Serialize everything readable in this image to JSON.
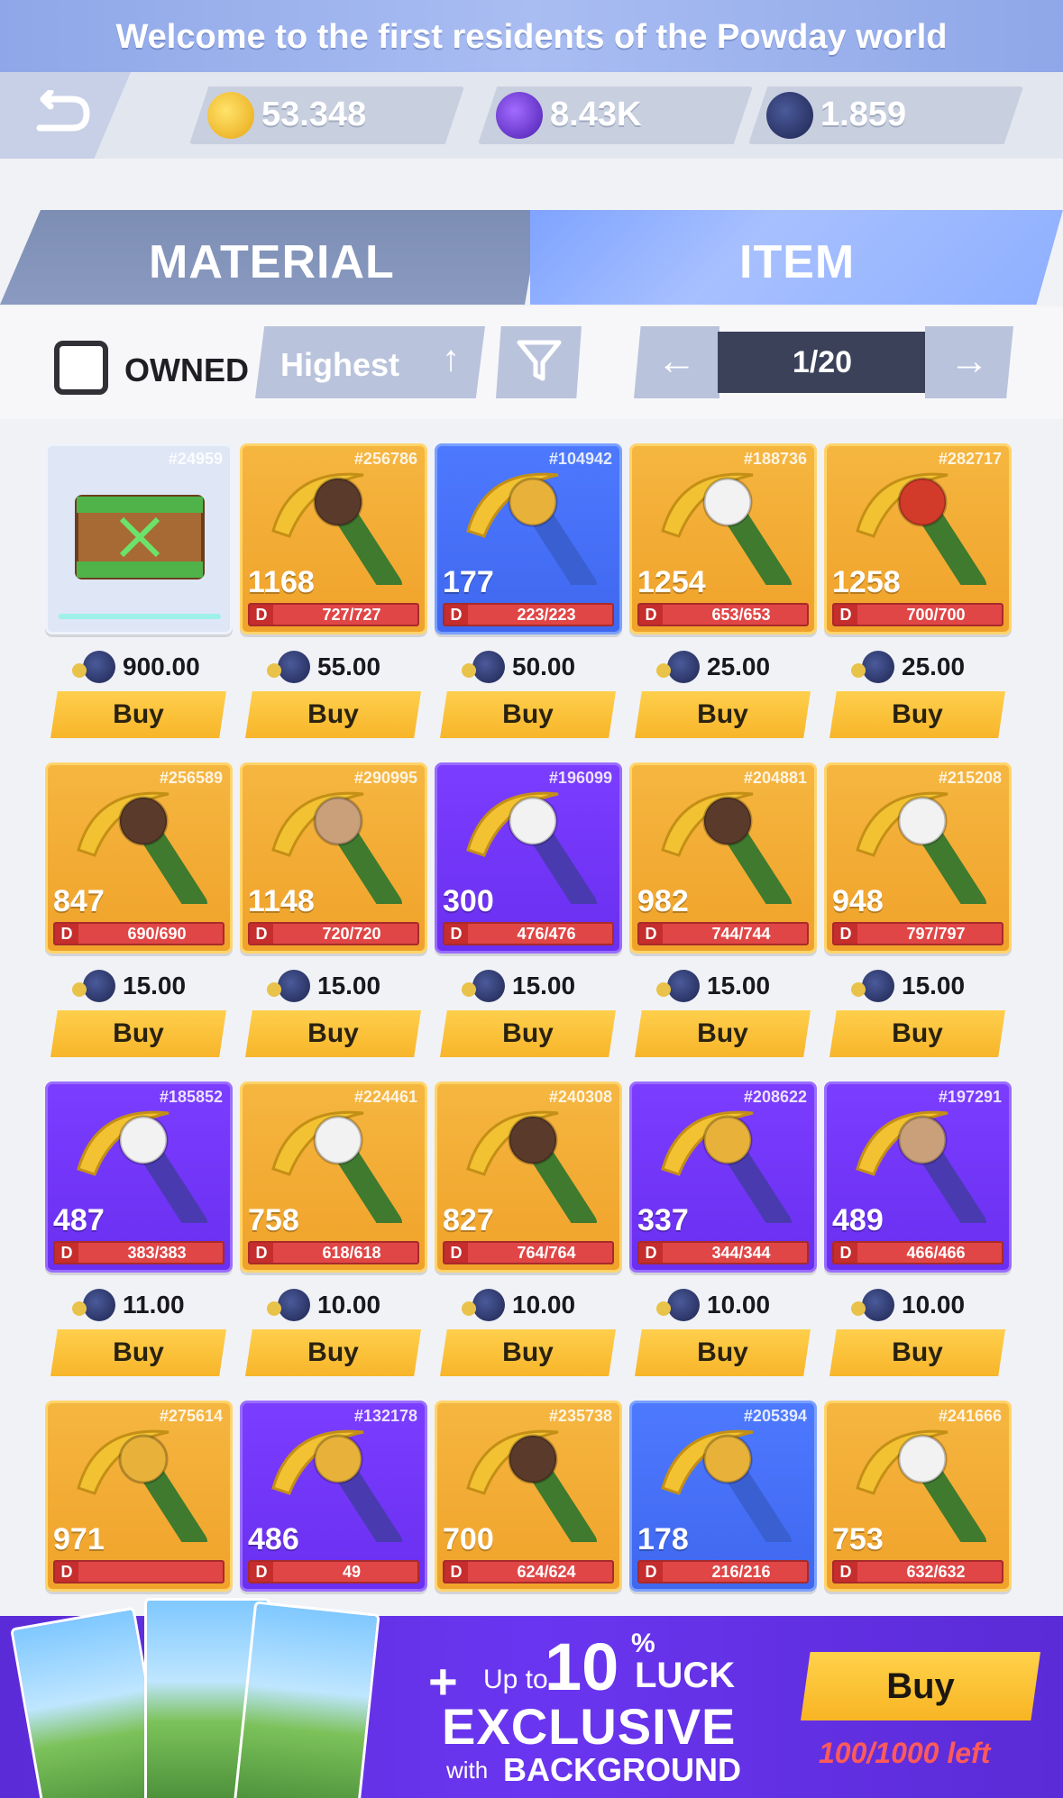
{
  "banner": {
    "text": "Welcome to the first residents of the Powday world"
  },
  "currencies": [
    {
      "icon": "gold-coin-icon",
      "value": "53.348"
    },
    {
      "icon": "e-gem-icon",
      "value": "8.43K"
    },
    {
      "icon": "sol-token-icon",
      "value": "1.859"
    }
  ],
  "tabs": {
    "material": "MATERIAL",
    "item": "ITEM"
  },
  "filters": {
    "owned_label": "OWNED",
    "sort_value": "Highest",
    "page": "1/20"
  },
  "items": [
    {
      "id": "#24959",
      "kind": "crate",
      "price": "900.00",
      "buy": "Buy"
    },
    {
      "id": "#256786",
      "kind": "gold",
      "head": "gorilla",
      "power": "1168",
      "dura": "727/727",
      "price": "55.00",
      "buy": "Buy"
    },
    {
      "id": "#104942",
      "kind": "blue",
      "head": "lion",
      "power": "177",
      "dura": "223/223",
      "price": "50.00",
      "buy": "Buy"
    },
    {
      "id": "#188736",
      "kind": "gold",
      "head": "wolf",
      "power": "1254",
      "dura": "653/653",
      "price": "25.00",
      "buy": "Buy"
    },
    {
      "id": "#282717",
      "kind": "gold",
      "head": "totem",
      "power": "1258",
      "dura": "700/700",
      "price": "25.00",
      "buy": "Buy"
    },
    {
      "id": "#256589",
      "kind": "gold",
      "head": "gorilla",
      "power": "847",
      "dura": "690/690",
      "price": "15.00",
      "buy": "Buy"
    },
    {
      "id": "#290995",
      "kind": "gold",
      "head": "elephant",
      "power": "1148",
      "dura": "720/720",
      "price": "15.00",
      "buy": "Buy"
    },
    {
      "id": "#196099",
      "kind": "purple",
      "head": "wolf",
      "power": "300",
      "dura": "476/476",
      "price": "15.00",
      "buy": "Buy"
    },
    {
      "id": "#204881",
      "kind": "gold",
      "head": "gorilla",
      "power": "982",
      "dura": "744/744",
      "price": "15.00",
      "buy": "Buy"
    },
    {
      "id": "#215208",
      "kind": "gold",
      "head": "wolf",
      "power": "948",
      "dura": "797/797",
      "price": "15.00",
      "buy": "Buy"
    },
    {
      "id": "#185852",
      "kind": "purple",
      "head": "wolf",
      "power": "487",
      "dura": "383/383",
      "price": "11.00",
      "buy": "Buy"
    },
    {
      "id": "#224461",
      "kind": "gold",
      "head": "wolf",
      "power": "758",
      "dura": "618/618",
      "price": "10.00",
      "buy": "Buy"
    },
    {
      "id": "#240308",
      "kind": "gold",
      "head": "gorilla",
      "power": "827",
      "dura": "764/764",
      "price": "10.00",
      "buy": "Buy"
    },
    {
      "id": "#208622",
      "kind": "purple",
      "head": "lion",
      "power": "337",
      "dura": "344/344",
      "price": "10.00",
      "buy": "Buy"
    },
    {
      "id": "#197291",
      "kind": "purple",
      "head": "elephant",
      "power": "489",
      "dura": "466/466",
      "price": "10.00",
      "buy": "Buy"
    },
    {
      "id": "#275614",
      "kind": "gold",
      "head": "lion",
      "power": "971",
      "dura": ""
    },
    {
      "id": "#132178",
      "kind": "purple",
      "head": "lion",
      "power": "486",
      "dura": "49"
    },
    {
      "id": "#235738",
      "kind": "gold",
      "head": "gorilla",
      "power": "700",
      "dura": "624/624"
    },
    {
      "id": "#205394",
      "kind": "blue",
      "head": "lion",
      "power": "178",
      "dura": "216/216"
    },
    {
      "id": "#241666",
      "kind": "gold",
      "head": "wolf",
      "power": "753",
      "dura": "632/632"
    }
  ],
  "promo": {
    "plus": "+",
    "up_to": "Up to",
    "amount": "10",
    "percent": "%",
    "luck": "LUCK",
    "exclusive": "EXCLUSIVE",
    "with": "with",
    "background": "BACKGROUND",
    "buy": "Buy",
    "left": "100/1000 left"
  }
}
